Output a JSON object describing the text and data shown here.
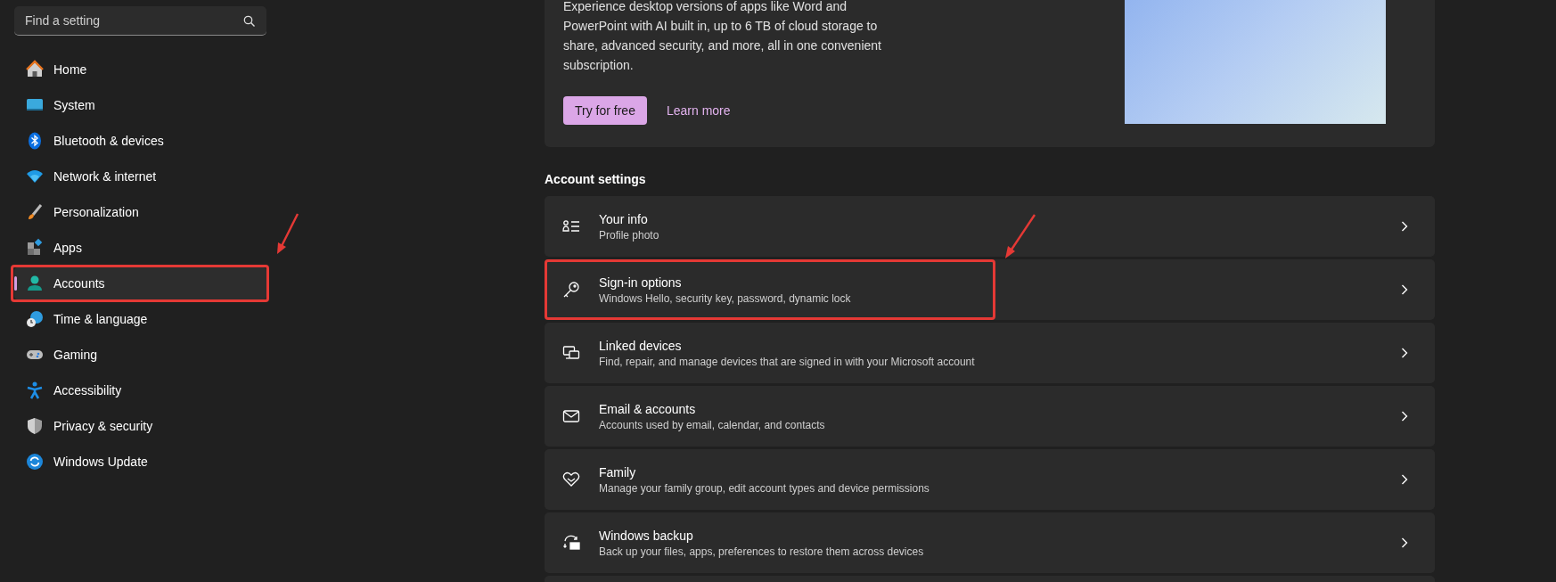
{
  "search": {
    "placeholder": "Find a setting"
  },
  "nav": [
    {
      "label": "Home",
      "selected": false,
      "highlighted": false
    },
    {
      "label": "System",
      "selected": false,
      "highlighted": false
    },
    {
      "label": "Bluetooth & devices",
      "selected": false,
      "highlighted": false
    },
    {
      "label": "Network & internet",
      "selected": false,
      "highlighted": false
    },
    {
      "label": "Personalization",
      "selected": false,
      "highlighted": false
    },
    {
      "label": "Apps",
      "selected": false,
      "highlighted": false
    },
    {
      "label": "Accounts",
      "selected": true,
      "highlighted": true
    },
    {
      "label": "Time & language",
      "selected": false,
      "highlighted": false
    },
    {
      "label": "Gaming",
      "selected": false,
      "highlighted": false
    },
    {
      "label": "Accessibility",
      "selected": false,
      "highlighted": false
    },
    {
      "label": "Privacy & security",
      "selected": false,
      "highlighted": false
    },
    {
      "label": "Windows Update",
      "selected": false,
      "highlighted": false
    }
  ],
  "promo": {
    "text": "Experience desktop versions of apps like Word and PowerPoint with AI built in, up to 6 TB of cloud storage to share, advanced security, and more, all in one convenient subscription.",
    "primary_button": "Try for free",
    "link": "Learn more"
  },
  "section_title": "Account settings",
  "rows": [
    {
      "title": "Your info",
      "subtitle": "Profile photo",
      "highlighted": false
    },
    {
      "title": "Sign-in options",
      "subtitle": "Windows Hello, security key, password, dynamic lock",
      "highlighted": true
    },
    {
      "title": "Linked devices",
      "subtitle": "Find, repair, and manage devices that are signed in with your Microsoft account",
      "highlighted": false
    },
    {
      "title": "Email & accounts",
      "subtitle": "Accounts used by email, calendar, and contacts",
      "highlighted": false
    },
    {
      "title": "Family",
      "subtitle": "Manage your family group, edit account types and device permissions",
      "highlighted": false
    },
    {
      "title": "Windows backup",
      "subtitle": "Back up your files, apps, preferences to restore them across devices",
      "highlighted": false
    }
  ]
}
